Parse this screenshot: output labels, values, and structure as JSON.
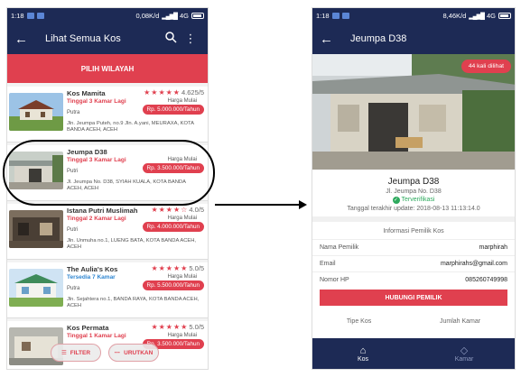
{
  "left": {
    "status": {
      "time": "1:18",
      "speed": "0,08K/d",
      "network": "4G"
    },
    "appbar": {
      "title": "Lihat Semua Kos"
    },
    "region_button": "PILIH WILAYAH",
    "price_label": "Harga Mulai",
    "listings": [
      {
        "name": "Kos Mamita",
        "stars": "★★★★★",
        "rating": "4.625/5",
        "availability": "Tinggal 3 Kamar Lagi",
        "type": "Putra",
        "price": "Rp. 5.000.000/Tahun",
        "address": "Jln. Jeumpa Puteh, no.9 Jln. A.yani, MEURAXA, KOTA BANDA ACEH, ACEH"
      },
      {
        "name": "Jeumpa D38",
        "stars": "",
        "rating": "",
        "availability": "Tinggal 3 Kamar Lagi",
        "type": "Putri",
        "price": "Rp. 3.500.000/Tahun",
        "address": "Jl. Jeumpa No. D38, SYIAH KUALA, KOTA BANDA ACEH, ACEH"
      },
      {
        "name": "Istana Putri Muslimah",
        "stars": "★★★★☆",
        "rating": "4.0/5",
        "availability": "Tinggal 2 Kamar Lagi",
        "type": "Putri",
        "price": "Rp. 4.000.000/Tahun",
        "address": "Jln. Unmuha no.1, LUENG BATA, KOTA BANDA ACEH, ACEH"
      },
      {
        "name": "The Aulia's Kos",
        "stars": "★★★★★",
        "rating": "5.0/5",
        "availability": "Tersedia 7 Kamar",
        "type": "Putra",
        "price": "Rp. 5.500.000/Tahun",
        "address": "Jln. Sejahtera no.1, BANDA RAYA, KOTA BANDA ACEH, ACEH"
      },
      {
        "name": "Kos Permata",
        "stars": "★★★★★",
        "rating": "5.0/5",
        "availability": "Tinggal 1 Kamar Lagi",
        "type": "",
        "price": "Rp. 3.500.000/Tahun",
        "address": ""
      }
    ],
    "filter_label": "FILTER",
    "sort_label": "URUTKAN"
  },
  "right": {
    "status": {
      "time": "1:18",
      "speed": "8,46K/d",
      "network": "4G"
    },
    "appbar": {
      "title": "Jeumpa D38"
    },
    "views_badge": "44 kali dilihat",
    "title": "Jeumpa D38",
    "address": "Jl. Jeumpa No. D38",
    "verified": "Terverifikasi",
    "updated": "Tanggal terakhir update: 2018-08-13 11:13:14.0",
    "owner_section": "Informasi Pemilik Kos",
    "owner_name_label": "Nama Pemilik",
    "owner_name": "marphirah",
    "email_label": "Email",
    "email": "marphirahs@gmail.com",
    "phone_label": "Nomor HP",
    "phone": "085260749998",
    "call_button": "HUBUNGI PEMILIK",
    "type_label": "Tipe Kos",
    "rooms_label": "Jumlah Kamar",
    "nav": {
      "kos": "Kos",
      "kamar": "Kamar"
    }
  },
  "colors": {
    "primary": "#1d2a55",
    "accent": "#e0404f",
    "verified": "#2eaa5e",
    "blue_text": "#2f86d1"
  }
}
